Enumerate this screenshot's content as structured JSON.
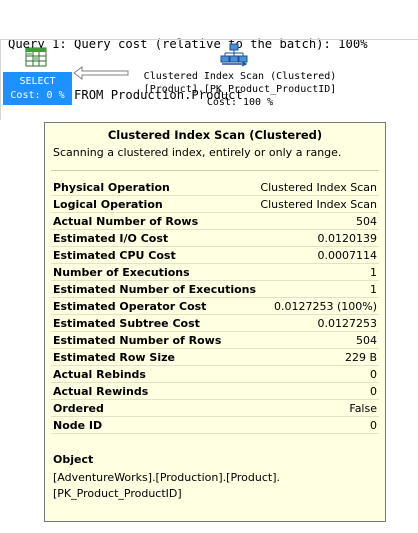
{
  "header": {
    "line1": "Query 1: Query cost (relative to the batch): 100%",
    "line2": "SELECT * FROM Production.Product"
  },
  "select_node": {
    "label": "SELECT",
    "cost": "Cost: 0 %",
    "icon": "select-table-icon"
  },
  "scan_node": {
    "icon": "clustered-index-scan-icon",
    "line1": "Clustered Index Scan (Clustered)",
    "line2": "[Product].[PK_Product_ProductID]",
    "line3": "Cost: 100 %"
  },
  "tooltip": {
    "title": "Clustered Index Scan (Clustered)",
    "description": "Scanning a clustered index, entirely or only a range.",
    "rows": [
      {
        "key": "Physical Operation",
        "value": "Clustered Index Scan"
      },
      {
        "key": "Logical Operation",
        "value": "Clustered Index Scan"
      },
      {
        "key": "Actual Number of Rows",
        "value": "504"
      },
      {
        "key": "Estimated I/O Cost",
        "value": "0.0120139"
      },
      {
        "key": "Estimated CPU Cost",
        "value": "0.0007114"
      },
      {
        "key": "Number of Executions",
        "value": "1"
      },
      {
        "key": "Estimated Number of Executions",
        "value": "1"
      },
      {
        "key": "Estimated Operator Cost",
        "value": "0.0127253 (100%)"
      },
      {
        "key": "Estimated Subtree Cost",
        "value": "0.0127253"
      },
      {
        "key": "Estimated Number of Rows",
        "value": "504"
      },
      {
        "key": "Estimated Row Size",
        "value": "229 B"
      },
      {
        "key": "Actual Rebinds",
        "value": "0"
      },
      {
        "key": "Actual Rewinds",
        "value": "0"
      },
      {
        "key": "Ordered",
        "value": "False"
      },
      {
        "key": "Node ID",
        "value": "0"
      }
    ],
    "object_title": "Object",
    "object_lines": [
      "[AdventureWorks].[Production].[Product].",
      "[PK_Product_ProductID]"
    ]
  },
  "colors": {
    "select_bg": "#1e90ff",
    "tooltip_bg": "#ffffe1",
    "tooltip_border": "#767676"
  }
}
